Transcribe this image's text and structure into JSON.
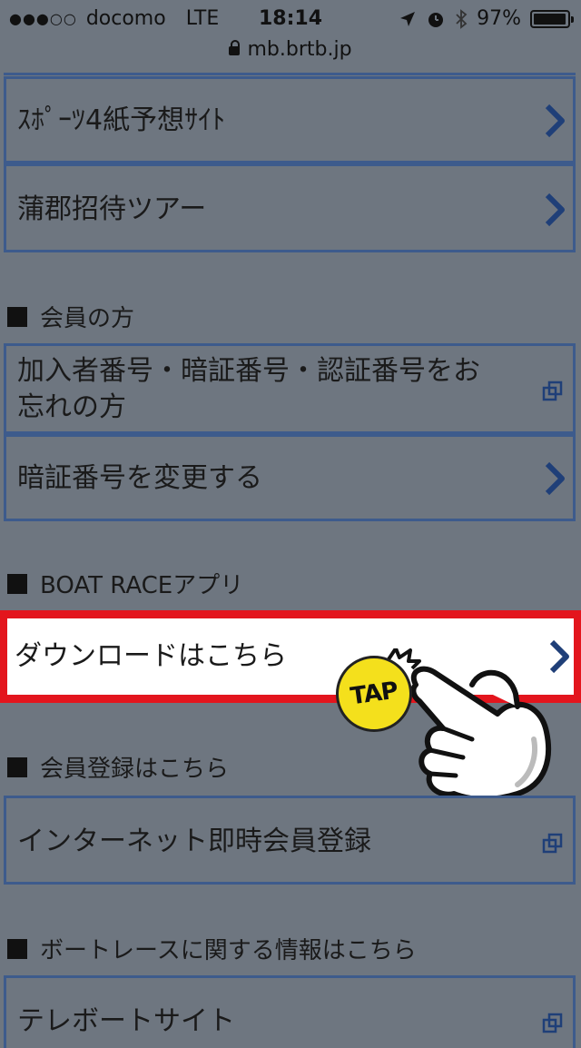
{
  "status_bar": {
    "signal": "●●●○○",
    "carrier": "docomo",
    "network": "LTE",
    "time": "18:14",
    "battery_percent": "97%",
    "battery_level": 0.97,
    "url": "mb.brtb.jp"
  },
  "menu_top": [
    {
      "label": "ｽﾎﾟｰﾂ4紙予想ｻｲﾄ",
      "icon": "chevron-right-icon"
    },
    {
      "label": "蒲郡招待ツアー",
      "icon": "chevron-right-icon"
    }
  ],
  "section_members": {
    "title": "会員の方",
    "items": [
      {
        "label_line1": "加入者番号・暗証番号・認証番号をお",
        "label_line2": "忘れの方",
        "icon": "external-link-icon"
      },
      {
        "label": "暗証番号を変更する",
        "icon": "chevron-right-icon"
      }
    ]
  },
  "section_app": {
    "title": "BOAT RACEアプリ",
    "items": [
      {
        "label": "ダウンロードはこちら",
        "icon": "chevron-right-icon"
      }
    ]
  },
  "tap_badge": "TAP",
  "section_register": {
    "title": "会員登録はこちら",
    "items": [
      {
        "label": "インターネット即時会員登録",
        "icon": "external-link-icon"
      }
    ]
  },
  "section_info": {
    "title": "ボートレースに関する情報はこちら",
    "items": [
      {
        "label": "テレボートサイト",
        "icon": "external-link-icon"
      }
    ]
  },
  "colors": {
    "background": "#6e7680",
    "border": "#3d5b8c",
    "chevron": "#1f3f78",
    "highlight": "#e3151d",
    "tap_badge": "#f4e01c"
  }
}
